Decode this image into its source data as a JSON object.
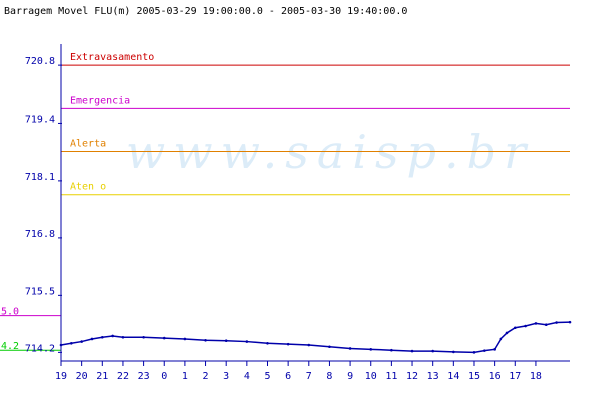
{
  "title": "Barragem Movel FLU(m) 2005-03-29 19:00:00.0 - 2005-03-30 19:40:00.0",
  "watermark": "www.saisp.br",
  "colors": {
    "axis": "#0000aa",
    "series": "#0000aa",
    "background": "#ffffff",
    "watermark": "#dcecf8"
  },
  "chart_data": {
    "type": "line",
    "title": "Barragem Movel FLU(m) 2005-03-29 19:00:00.0 - 2005-03-30 19:40:00.0",
    "xlabel": "",
    "ylabel": "",
    "grid": false,
    "ylim": [
      713.95,
      721.15
    ],
    "y_ticks": [
      "720.8",
      "719.4",
      "718.1",
      "716.8",
      "715.5",
      "714.2"
    ],
    "y_tick_values": [
      720.8,
      719.45,
      718.12,
      716.8,
      715.47,
      714.15
    ],
    "x_ticks": [
      "19",
      "20",
      "21",
      "22",
      "23",
      "0",
      "1",
      "2",
      "3",
      "4",
      "5",
      "6",
      "7",
      "8",
      "9",
      "10",
      "11",
      "12",
      "13",
      "14",
      "15",
      "16",
      "17",
      "18"
    ],
    "xlim": [
      19.0,
      43.65
    ],
    "reference_lines": [
      {
        "name": "Extravasamento",
        "value": 720.8,
        "color": "#cc0000"
      },
      {
        "name": "Emergencia",
        "value": 719.8,
        "color": "#cc00cc"
      },
      {
        "name": "Alerta",
        "value": 718.8,
        "color": "#e08000"
      },
      {
        "name": "Aten  o",
        "value": 717.8,
        "color": "#e8d000"
      }
    ],
    "side_markers": [
      {
        "label": "5.0",
        "value": 715.0,
        "color": "#cc00cc"
      },
      {
        "label": "4.2",
        "value": 714.2,
        "color": "#00cc00"
      }
    ],
    "series": [
      {
        "x": [
          19.0,
          19.5,
          20.0,
          20.5,
          21.0,
          21.5,
          22.0,
          23.0,
          24.0,
          25.0,
          26.0,
          27.0,
          28.0,
          29.0,
          30.0,
          31.0,
          32.0,
          33.0,
          34.0,
          35.0,
          36.0,
          37.0,
          38.0,
          39.0,
          39.5,
          40.0,
          40.3,
          40.6,
          41.0,
          41.5,
          42.0,
          42.5,
          43.0,
          43.65
        ],
        "values": [
          714.32,
          714.36,
          714.4,
          714.46,
          714.5,
          714.53,
          714.5,
          714.5,
          714.48,
          714.46,
          714.43,
          714.42,
          714.4,
          714.36,
          714.34,
          714.32,
          714.28,
          714.24,
          714.22,
          714.2,
          714.18,
          714.18,
          714.16,
          714.15,
          714.19,
          714.22,
          714.46,
          714.6,
          714.72,
          714.76,
          714.82,
          714.79,
          714.84,
          714.85
        ]
      }
    ]
  }
}
